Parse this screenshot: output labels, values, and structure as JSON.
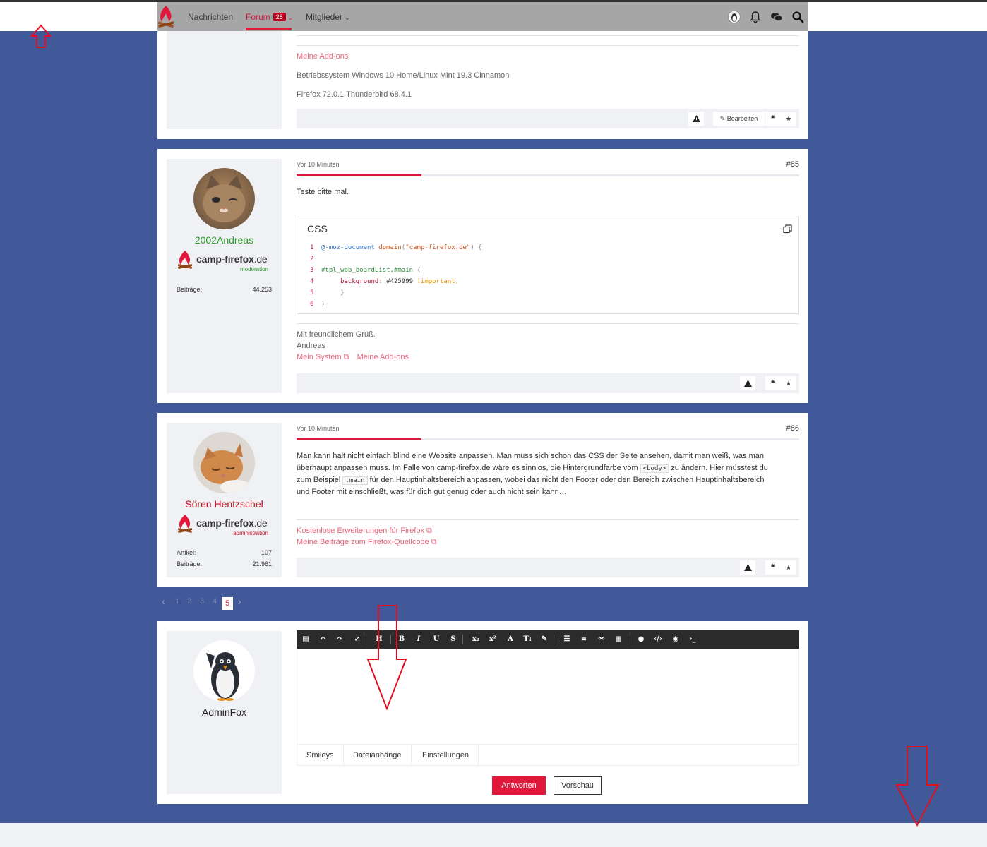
{
  "nav": {
    "items": [
      {
        "label": "Nachrichten"
      },
      {
        "label": "Forum",
        "badge": "28"
      },
      {
        "label": "Mitglieder"
      }
    ]
  },
  "post_prev": {
    "links": [
      "Meine Add-ons"
    ],
    "sig_lines": [
      "Betriebssystem Windows 10 Home/Linux Mint 19.3 Cinnamon",
      "Firefox 72.0.1 Thunderbird 68.4.1"
    ],
    "edit_label": "Bearbeiten"
  },
  "post85": {
    "time": "Vor 10 Minuten",
    "number": "#85",
    "author": "2002Andreas",
    "author_color": "#2e9a2e",
    "brand_sub": "moderation",
    "stat_label": "Beiträge:",
    "stat_value": "44.253",
    "text": "Teste bitte mal.",
    "code_lang": "CSS",
    "code_lines": [
      {
        "n": "1",
        "parts": [
          [
            "at",
            "@-moz-document"
          ],
          [
            "fn",
            " domain"
          ],
          [
            "pun",
            "("
          ],
          [
            "str",
            "\"camp-firefox.de\""
          ],
          [
            "pun",
            ") {"
          ]
        ]
      },
      {
        "n": "2",
        "parts": []
      },
      {
        "n": "3",
        "parts": [
          [
            "sel",
            "#tpl_wbb_boardList,#main"
          ],
          [
            "pun",
            " {"
          ]
        ]
      },
      {
        "n": "4",
        "parts": [
          [
            "plain",
            "     "
          ],
          [
            "prop",
            "background"
          ],
          [
            "pun",
            ": "
          ],
          [
            "plain",
            "#425999 "
          ],
          [
            "imp",
            "!important"
          ],
          [
            "pun",
            ";"
          ]
        ]
      },
      {
        "n": "5",
        "parts": [
          [
            "pun",
            "     }"
          ]
        ]
      },
      {
        "n": "6",
        "parts": [
          [
            "pun",
            "}"
          ]
        ]
      }
    ],
    "sig_greeting": "Mit freundlichem Gruß.",
    "sig_name": "Andreas",
    "sig_link1": "Mein System",
    "sig_link2": "Meine Add-ons"
  },
  "post86": {
    "time": "Vor 10 Minuten",
    "number": "#86",
    "author": "Sören Hentzschel",
    "author_color": "#cc1020",
    "brand_sub": "administration",
    "stat1_label": "Artikel:",
    "stat1_value": "107",
    "stat2_label": "Beiträge:",
    "stat2_value": "21.961",
    "text_a": "Man kann halt nicht einfach blind eine Website anpassen. Man muss sich schon das CSS der Seite ansehen, damit man weiß, was man",
    "text_b1": "überhaupt anpassen muss. Im Falle von camp-firefox.de wäre es sinnlos, die Hintergrundfarbe vom ",
    "code_body": "<body>",
    "text_b2": " zu ändern. Hier müsstest du",
    "text_c1": "zum Beispiel ",
    "code_main": ".main",
    "text_c2": " für den Hauptinhaltsbereich anpassen, wobei das nicht den Footer oder den Bereich zwischen Hauptinhaltsbereich",
    "text_d": "und Footer mit einschließt, was für dich gut genug oder auch nicht sein kann…",
    "sig_link1": "Kostenlose Erweiterungen für Firefox",
    "sig_link2": "Meine Beiträge zum Firefox-Quellcode"
  },
  "brand": {
    "name": "camp-firefox",
    "tld": ".de"
  },
  "pagination": [
    "1",
    "2",
    "3",
    "4",
    "5"
  ],
  "pagination_current": "5",
  "reply": {
    "author": "AdminFox",
    "toolbar_glyphs": [
      "▤",
      "↶",
      "↷",
      "⤢",
      "H",
      "B",
      "I",
      "U",
      "S",
      "x₂",
      "x²",
      "A",
      "Tı",
      "✎",
      "☰",
      "≡",
      "⚯",
      "▦",
      "●",
      "‹/›",
      "◉",
      "›_"
    ],
    "tabs": [
      "Smileys",
      "Dateianhänge",
      "Einstellungen"
    ],
    "submit_label": "Antworten",
    "preview_label": "Vorschau"
  },
  "colors": {
    "accent": "#e0183c",
    "background": "#425999",
    "overlay_arrows": "#e01020"
  }
}
